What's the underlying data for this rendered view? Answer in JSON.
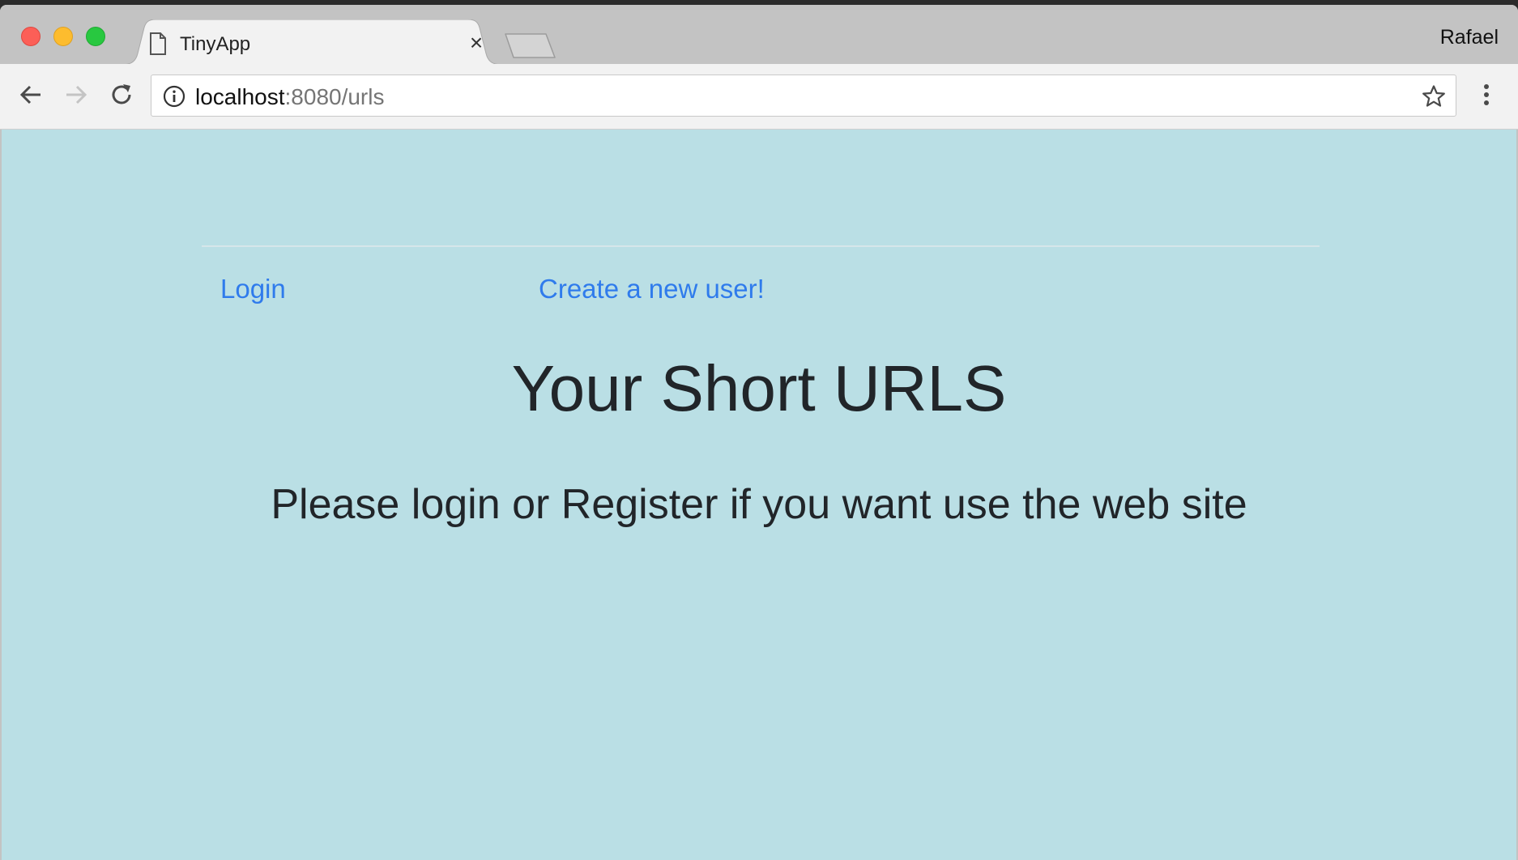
{
  "browser": {
    "tab": {
      "title": "TinyApp",
      "close_glyph": "×"
    },
    "profile_name": "Rafael",
    "address": {
      "host": "localhost",
      "rest": ":8080/urls"
    },
    "icons": {
      "tab": "document-icon",
      "back": "back-arrow-icon",
      "forward": "forward-arrow-icon",
      "reload": "reload-icon",
      "info": "info-icon",
      "bookmark": "star-icon",
      "menu": "kebab-menu-icon"
    }
  },
  "page": {
    "background_color": "#badfe5",
    "link_color": "#2f7bec",
    "nav": {
      "login_label": "Login",
      "register_label": "Create a new user!"
    },
    "title": "Your Short URLS",
    "message": "Please login or Register if you want use the web site"
  }
}
